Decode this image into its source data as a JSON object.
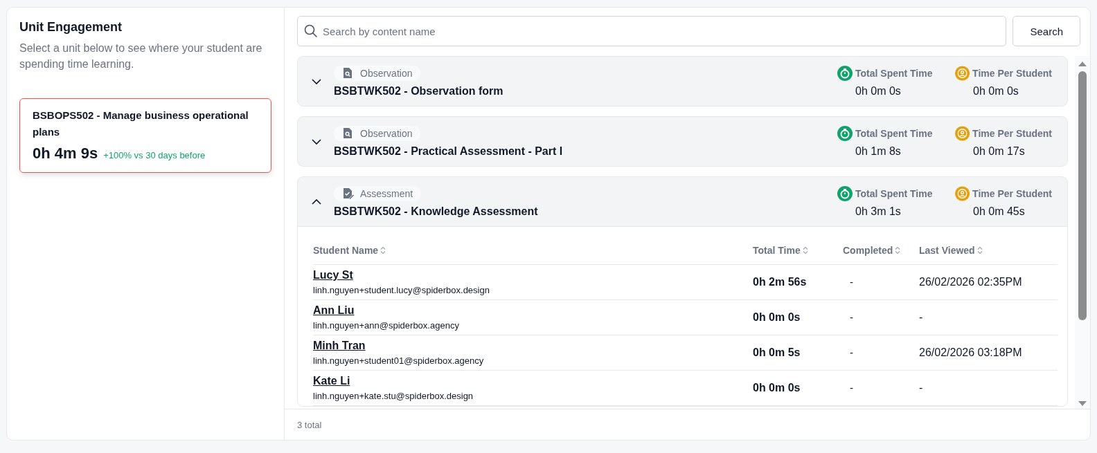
{
  "sidebar": {
    "title": "Unit Engagement",
    "description": "Select a unit below to see where your student are spending time learning.",
    "units": [
      {
        "name": "BSBOPS502 - Manage business operational plans",
        "time": "0h 4m 9s",
        "trend": "+100% vs 30 days before",
        "selected": true
      }
    ]
  },
  "search": {
    "placeholder": "Search by content name",
    "button": "Search"
  },
  "contents": [
    {
      "kind": "observation",
      "type_label": "Observation",
      "title": "BSBTWK502 - Observation form",
      "expanded": false,
      "total_label": "Total Spent Time",
      "total": "0h 0m 0s",
      "per_label": "Time Per Student",
      "per": "0h 0m 0s"
    },
    {
      "kind": "observation",
      "type_label": "Observation",
      "title": "BSBTWK502 - Practical Assessment - Part I",
      "expanded": false,
      "total_label": "Total Spent Time",
      "total": "0h 1m 8s",
      "per_label": "Time Per Student",
      "per": "0h 0m 17s"
    },
    {
      "kind": "assessment",
      "type_label": "Assessment",
      "title": "BSBTWK502 - Knowledge Assessment",
      "expanded": true,
      "total_label": "Total Spent Time",
      "total": "0h 3m 1s",
      "per_label": "Time Per Student",
      "per": "0h 0m 45s",
      "table": {
        "columns": [
          "Student Name",
          "Total Time",
          "Completed",
          "Last Viewed"
        ],
        "rows": [
          {
            "name": "Lucy St",
            "email": "linh.nguyen+student.lucy@spiderbox.design",
            "total_time": "0h 2m 56s",
            "completed": "-",
            "last_viewed": "26/02/2026 02:35PM"
          },
          {
            "name": "Ann Liu",
            "email": "linh.nguyen+ann@spiderbox.agency",
            "total_time": "0h 0m 0s",
            "completed": "-",
            "last_viewed": "-"
          },
          {
            "name": "Minh Tran",
            "email": "linh.nguyen+student01@spiderbox.agency",
            "total_time": "0h 0m 5s",
            "completed": "-",
            "last_viewed": "26/02/2026 03:18PM"
          },
          {
            "name": "Kate Li",
            "email": "linh.nguyen+kate.stu@spiderbox.design",
            "total_time": "0h 0m 0s",
            "completed": "-",
            "last_viewed": "-"
          }
        ]
      }
    }
  ],
  "footer": {
    "total": "3 total"
  }
}
